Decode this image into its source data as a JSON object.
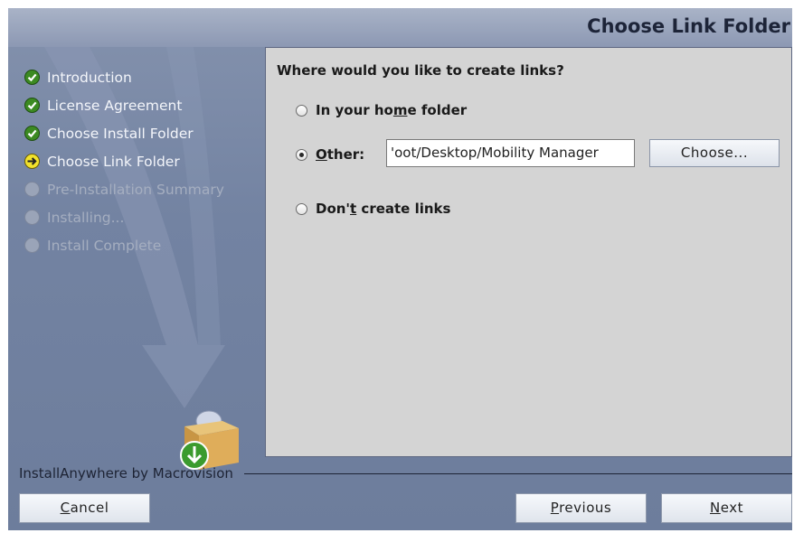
{
  "header": {
    "title": "Choose Link Folder"
  },
  "steps": [
    {
      "label": "Introduction",
      "status": "done"
    },
    {
      "label": "License Agreement",
      "status": "done"
    },
    {
      "label": "Choose Install Folder",
      "status": "done"
    },
    {
      "label": "Choose Link Folder",
      "status": "current"
    },
    {
      "label": "Pre-Installation Summary",
      "status": "pending"
    },
    {
      "label": "Installing...",
      "status": "pending"
    },
    {
      "label": "Install Complete",
      "status": "pending"
    }
  ],
  "content": {
    "question": "Where would you like to create links?",
    "options": {
      "home": {
        "pre": "In your ho",
        "mnemonic": "m",
        "post": "e folder",
        "selected": false
      },
      "other": {
        "pre": "",
        "mnemonic": "O",
        "post": "ther:",
        "selected": true
      },
      "none": {
        "pre": "Don'",
        "mnemonic": "t",
        "post": " create links",
        "selected": false
      }
    },
    "path_value": "'oot/Desktop/Mobility Manager",
    "choose_label": "Choose..."
  },
  "footer": {
    "brand": "InstallAnywhere by Macrovision",
    "cancel": {
      "mnemonic": "C",
      "rest": "ancel"
    },
    "previous": {
      "mnemonic": "P",
      "rest": "revious"
    },
    "next": {
      "mnemonic": "N",
      "rest": "ext"
    }
  },
  "colors": {
    "sidebar": "#7383a2",
    "content_bg": "#d4d4d4",
    "done_icon": "#3c8a22",
    "current_icon": "#f2e22c"
  }
}
